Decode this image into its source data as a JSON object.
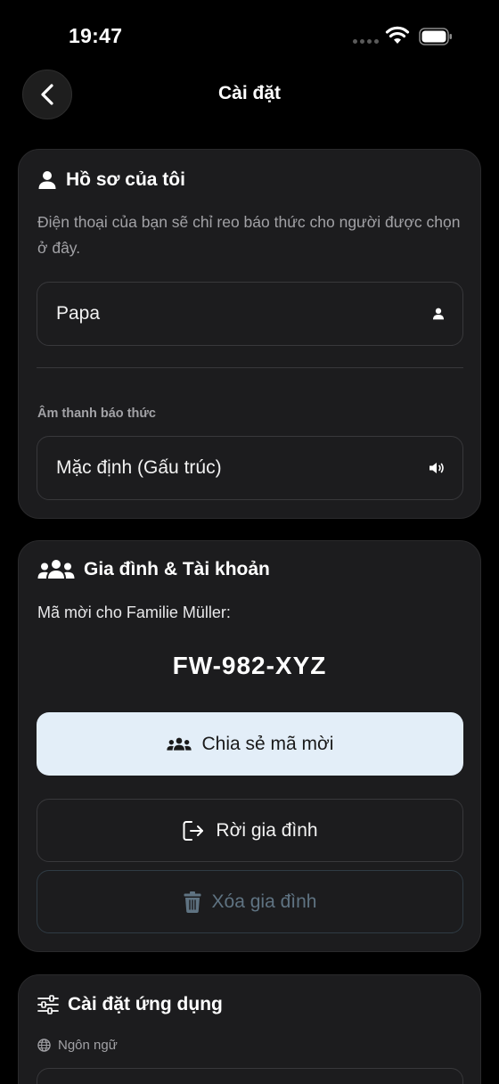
{
  "status_bar": {
    "time": "19:47"
  },
  "nav": {
    "title": "Cài đặt"
  },
  "profile_card": {
    "title": "Hồ sơ của tôi",
    "description": "Điện thoại của bạn sẽ chỉ reo báo thức cho người được chọn ở đây.",
    "name_value": "Papa",
    "sound_label": "Âm thanh báo thức",
    "sound_value": "Mặc định (Gấu trúc)"
  },
  "family_card": {
    "title": "Gia đình & Tài khoản",
    "invite_text": "Mã mời cho Familie Müller:",
    "invite_code": "FW-982-XYZ",
    "share_label": "Chia sẻ mã mời",
    "leave_label": "Rời gia đình",
    "delete_label": "Xóa gia đình"
  },
  "app_card": {
    "title": "Cài đặt ứng dụng",
    "language_label": "Ngôn ngữ"
  },
  "icons": {
    "back": "chevron-left-icon",
    "profile": "person-icon",
    "name_field": "person-icon",
    "sound": "speaker-icon",
    "family": "group-icon",
    "share": "group-icon",
    "leave": "exit-icon",
    "delete": "trash-icon",
    "app_settings": "sliders-icon",
    "language": "globe-icon"
  },
  "colors": {
    "background": "#000000",
    "card": "#1c1c1e",
    "primary_button": "#e3eef8",
    "muted_text": "#a2a2a6",
    "disabled_text": "#5f7382"
  }
}
